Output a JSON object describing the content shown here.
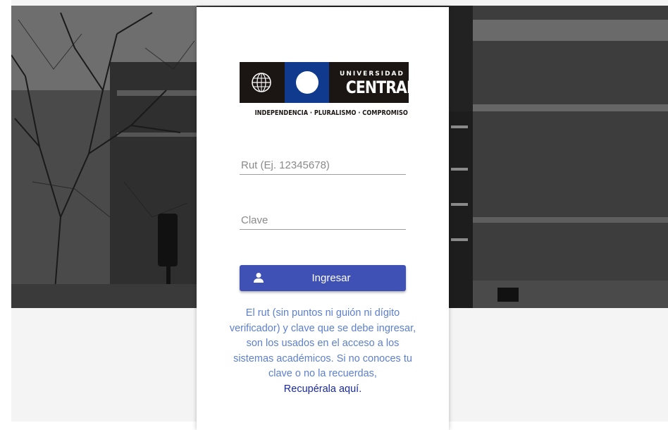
{
  "logo": {
    "word_top": "UNIVERSIDAD",
    "word_main": "CENTRAL",
    "tagline": "INDEPENDENCIA · PLURALISMO · COMPROMISO",
    "colors": {
      "band": "#1b1614",
      "blue": "#0f3a8d"
    }
  },
  "form": {
    "rut_placeholder": "Rut (Ej. 12345678)",
    "clave_placeholder": "Clave",
    "submit_label": "Ingresar",
    "submit_icon": "user-icon",
    "accent": "#3f51b5"
  },
  "help": {
    "text": "El rut (sin puntos ni guión ni dígito verificador) y clave que se debe ingresar, son los usados en el acceso a los sistemas académicos. Si no conoces tu clave o no la recuerdas,",
    "link_text": "Recupérala aquí."
  }
}
